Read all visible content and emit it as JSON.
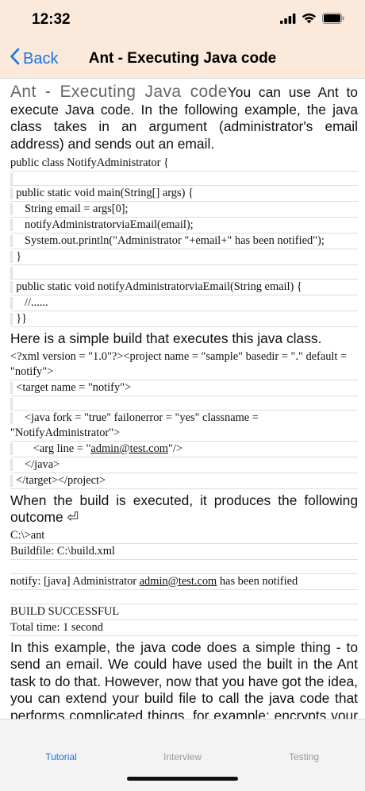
{
  "status_bar": {
    "time": "12:32",
    "icons": [
      "signal-icon",
      "wifi-icon",
      "battery-icon"
    ]
  },
  "nav": {
    "back_label": "Back",
    "title": "Ant - Executing Java code"
  },
  "content": {
    "heading": "Ant - Executing Java code",
    "intro": "You can use Ant to execute Java code. In the following example, the java class takes in an argument (administrator's email address) and sends out an email.",
    "java_code": [
      "public class NotifyAdministrator {",
      "",
      "  public static void main(String[] args) {",
      "     String email = args[0];",
      "     notifyAdministratorviaEmail(email);",
      "     System.out.println(\"Administrator \"+email+\" has been notified\");",
      "  }",
      "",
      "  public static void notifyAdministratorviaEmail(String email) {",
      "     //......",
      "  }}"
    ],
    "build_intro": "Here is a simple build that executes this java class.",
    "xml_code": [
      "<?xml version = \"1.0\"?><project name = \"sample\" basedir = \".\" default = \"notify\">",
      "  <target name = \"notify\">",
      "",
      "     <java fork = \"true\" failonerror = \"yes\" classname = \"NotifyAdministrator\">",
      "        <arg line = \"admin@test.com\"/>",
      "     </java>",
      "  </target></project>"
    ],
    "outcome_intro": "When the build is executed, it produces the following outcome ⏎",
    "output_code": [
      "C:\\>ant",
      "Buildfile: C:\\build.xml",
      "",
      "notify: [java] Administrator admin@test.com has been notified",
      "",
      "BUILD SUCCESSFUL",
      "Total time: 1 second"
    ],
    "closing": "In this example, the java code does a simple thing - to send an email. We could have used the built in the Ant task to do that. However, now that you have got the idea, you can extend your build file to call the java code that performs complicated things, for example: encrypts your source code."
  },
  "tabs": [
    {
      "label": "Tutorial",
      "active": true
    },
    {
      "label": "Interview",
      "active": false
    },
    {
      "label": "Testing",
      "active": false
    }
  ],
  "colors": {
    "accent": "#1a73e8",
    "header_bg": "#fbe9dc",
    "tab_inactive": "#9a9a9a"
  }
}
